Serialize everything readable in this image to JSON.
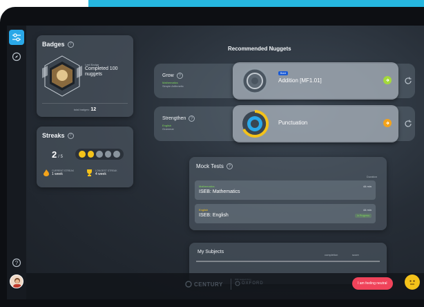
{
  "badges": {
    "title": "Badges",
    "last_badge_label": "Last Badge",
    "last_badge_text": "Completed 100 nuggets",
    "total_label": "total badges:",
    "total_value": "12"
  },
  "streaks": {
    "title": "Streaks",
    "current": "2",
    "of": "/ 5",
    "current_streak_label": "CURRENT STREAK",
    "current_streak_value": "1 week",
    "longest_streak_label": "LONGEST STREAK",
    "longest_streak_value": "4 week"
  },
  "recommended": {
    "title": "Recommended Nuggets",
    "items": [
      {
        "section": "Grow",
        "subject": "Mathematics",
        "topic": "Simple Arithmetic",
        "tag": "Bond",
        "name": "Addition [MF1.01]",
        "action_color": "#a4d93a"
      },
      {
        "section": "Strengthen",
        "subject": "English",
        "topic": "Grammar",
        "tag": "",
        "name": "Punctuation",
        "action_color": "#f4a31a"
      }
    ]
  },
  "mock_tests": {
    "title": "Mock Tests",
    "duration_header": "Duration",
    "items": [
      {
        "subject": "Mathematics",
        "name": "ISEB: Mathematics",
        "duration": "44 min",
        "status": ""
      },
      {
        "subject": "English",
        "name": "ISEB: English",
        "duration": "44 min",
        "status": "In Progress"
      }
    ]
  },
  "subjects": {
    "title": "My Subjects",
    "col_completion": "completion",
    "col_score": "score"
  },
  "footer": {
    "brand": "CENTURY",
    "partner_small": "With support from",
    "partner": "OXFORD",
    "feeling_button": "I am feeling neutral"
  },
  "colors": {
    "accent": "#2aa8e8",
    "teal": "#26b7e0",
    "feel_btn": "#f0435a",
    "yellow": "#f4c21a",
    "green": "#7ed957"
  }
}
